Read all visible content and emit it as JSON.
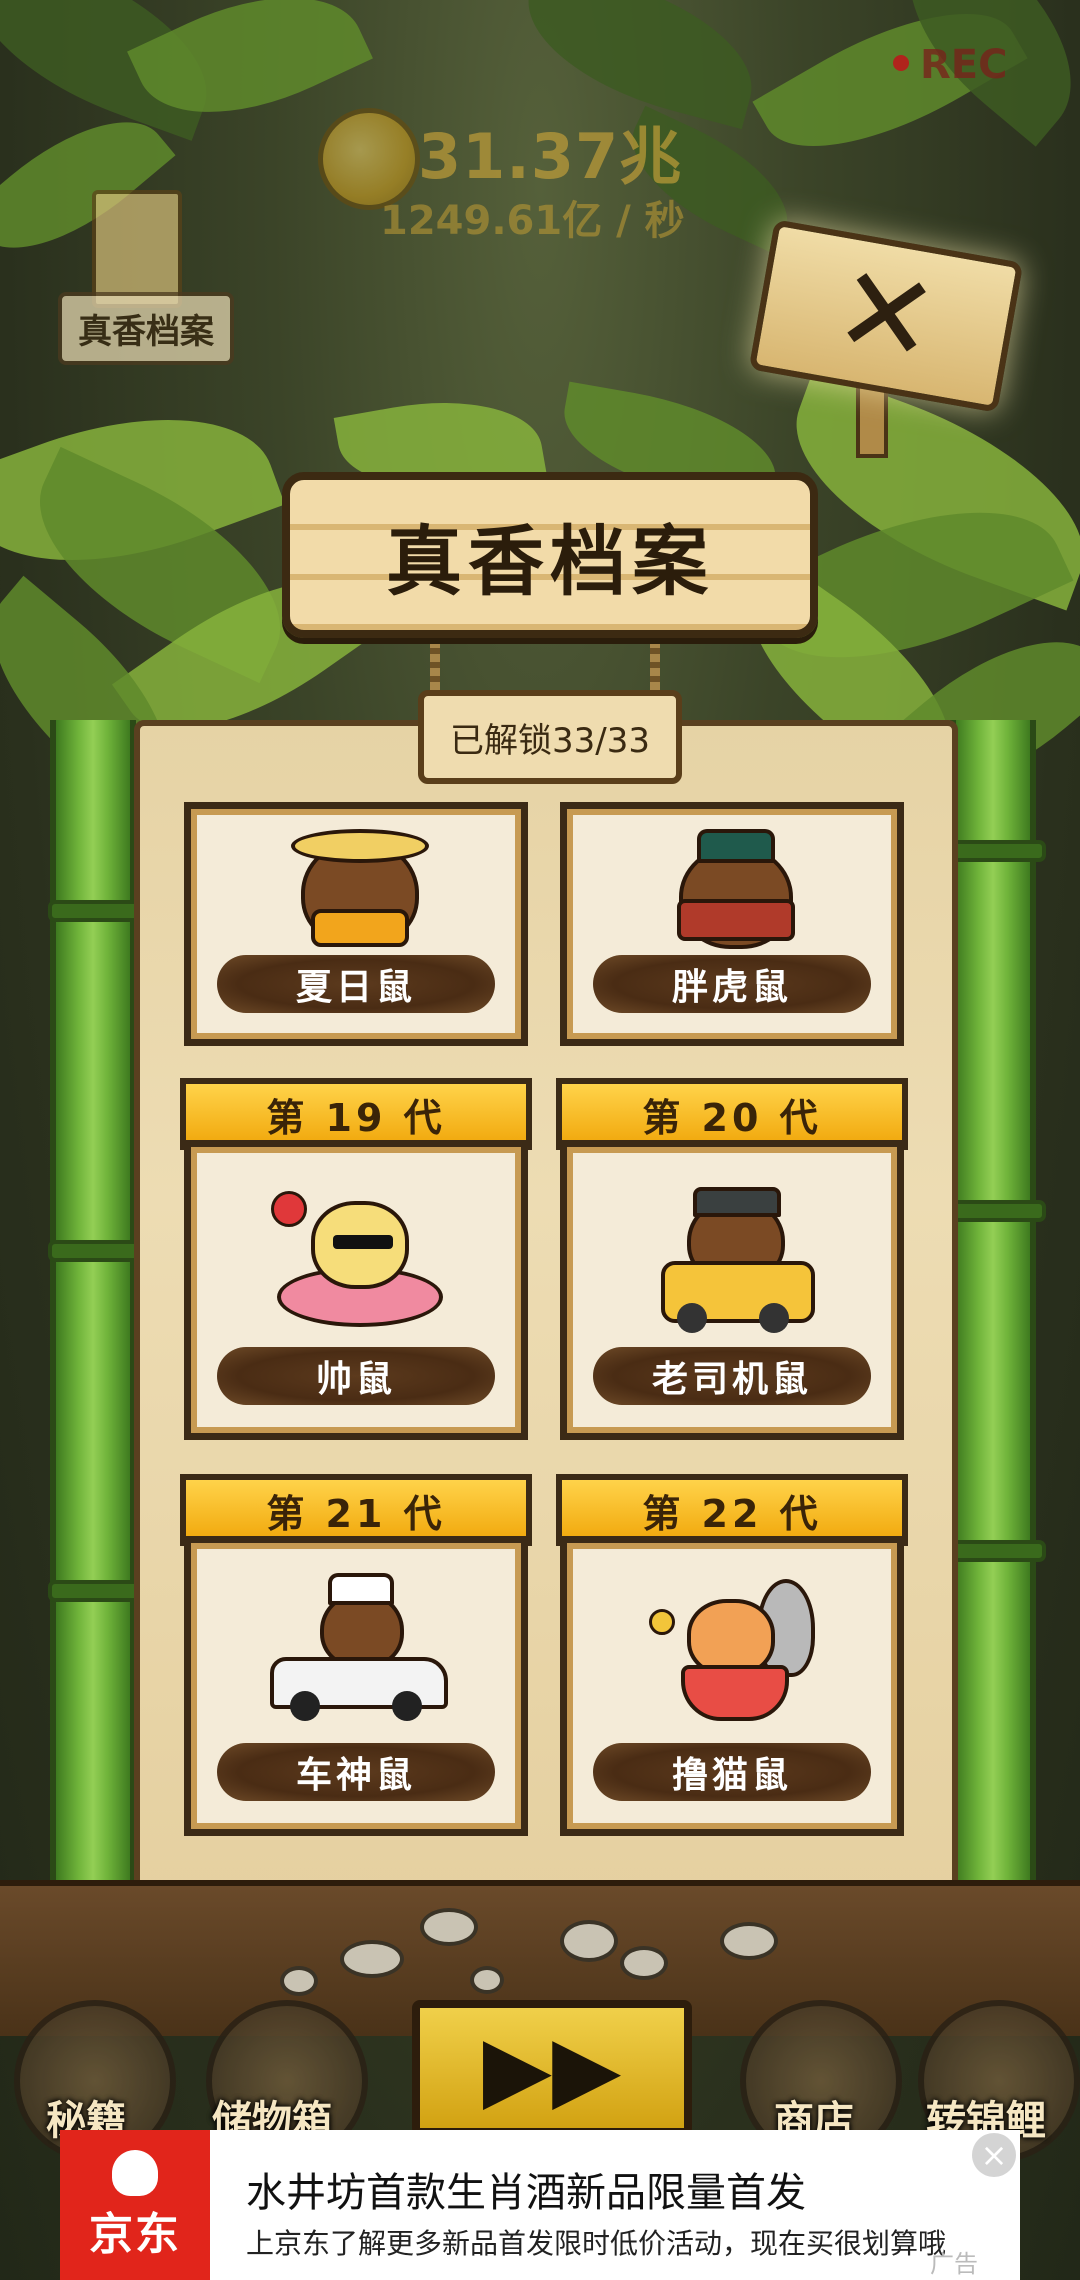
{
  "hud": {
    "coin_amount": "31.37兆",
    "coin_rate": "1249.61亿 / 秒",
    "recording": "REC"
  },
  "background": {
    "archive_label": "真香档案"
  },
  "title": "真香档案",
  "unlock_status": "已解锁33/33",
  "cards": [
    {
      "name": "夏日鼠",
      "generation": ""
    },
    {
      "name": "胖虎鼠",
      "generation": ""
    },
    {
      "name": "帅鼠",
      "generation": "第 19 代"
    },
    {
      "name": "老司机鼠",
      "generation": "第 20 代"
    },
    {
      "name": "车神鼠",
      "generation": "第 21 代"
    },
    {
      "name": "撸猫鼠",
      "generation": "第 22 代"
    }
  ],
  "bottom_nav": {
    "secrets": "秘籍",
    "storage": "储物箱",
    "shop": "商店",
    "koi": "转锦鲤",
    "fast_forward": "▶▶"
  },
  "ad": {
    "brand": "京东",
    "title": "水井坊首款生肖酒新品限量首发",
    "subtitle": "上京东了解更多新品首发限时低价活动，现在买很划算哦",
    "tag": "广告",
    "close": "×",
    "brand_color": "#e1251b"
  }
}
